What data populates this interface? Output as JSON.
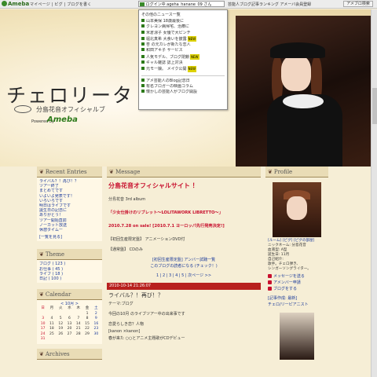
{
  "topbar": {
    "logo": "Ameba",
    "links": "マイページ | ピグ | ブログを書く",
    "status_text": "ログイン中 ageha_hanane_09 さん",
    "right_text": "芸能人ブログ記事ランキング  アメーバ会員登録",
    "action_button": "アメブロ検索"
  },
  "news_popup": {
    "heading": "その他のニュース一覧",
    "items": [
      {
        "text": "山本美保 18歳最後に",
        "tag": ""
      },
      {
        "text": "クレヨン病帰宅、治療に",
        "tag": ""
      },
      {
        "text": "米倉涼子 女優で大ピンチ",
        "tag": ""
      },
      {
        "text": "堀北真希 大食いを披露",
        "tag": "NEW"
      },
      {
        "text": "杏 の元カレが新たな恋人",
        "tag": ""
      },
      {
        "text": "和田アキ子 サービス",
        "tag": ""
      },
      {
        "text": "人気モデル、ブログ閉鎖",
        "tag": "NEW"
      },
      {
        "text": "ギャル雑誌 誌上対決",
        "tag": ""
      },
      {
        "text": "元モー娘。 メイク公開",
        "tag": "NEW"
      }
    ],
    "bottom_items": [
      "アメ芸能人のBlog記念日",
      "有名ブロガーの映画コラム",
      "懐かしの芸能人がブログ開設"
    ]
  },
  "header": {
    "title": "チェロリータ",
    "subtitle": "分島花音オフィシャルブ",
    "powered": "Powered by",
    "ameba_mark": "Ameba"
  },
  "left": {
    "recent_entries_title": "Recent Entries",
    "recent_entries": [
      "ライバル？！再び！？",
      "ツアー終了",
      "まとめてです",
      "いよいよ発表です！",
      "いろいろです",
      "明日はライブです",
      "誕生日の記念に",
      "ありがとう！",
      "ツアー開始直前",
      "ノーカット放送",
      "休憩タイムー",
      "[一覧を見る]"
    ],
    "theme_title": "Theme",
    "themes": [
      "ブログ ( 123 )",
      "お仕事 ( 45 )",
      "ライブ ( 18 )",
      "日記 ( 100 )"
    ],
    "calendar_title": "Calendar",
    "calendar_month": "< 10月 >",
    "calendar_days": [
      "日",
      "月",
      "火",
      "水",
      "木",
      "金",
      "土"
    ],
    "calendar_rows": [
      [
        "",
        "",
        "",
        "",
        "",
        "1",
        "2"
      ],
      [
        "3",
        "4",
        "5",
        "6",
        "7",
        "8",
        "9"
      ],
      [
        "10",
        "11",
        "12",
        "13",
        "14",
        "15",
        "16"
      ],
      [
        "17",
        "18",
        "19",
        "20",
        "21",
        "22",
        "23"
      ],
      [
        "24",
        "25",
        "26",
        "27",
        "28",
        "29",
        "30"
      ],
      [
        "31",
        "",
        "",
        "",
        "",
        "",
        ""
      ]
    ],
    "archives_title": "Archives"
  },
  "main": {
    "section_title": "Message",
    "message_title": "分島花音オフィシャルサイト ！",
    "line1": "分島花音 3rd album",
    "line2": "「少女仕掛けのリブレット～LOLITAWORK LIBRETTO～」",
    "line3": "2010.7.28 on sale! [2010.7.1 ヨーロッパ先行発売決定!]",
    "line4": "【初回生産限定盤】 アニメーションDVD付",
    "line5": "【通常盤】 CDのみ",
    "link1": "[初回生産限定盤] アンバー試聴一覧",
    "link2": "このブログの読者になる (チェック！)",
    "pager": "1 | 2 | 3 | 4 | 5 | 次ページ >>",
    "entry_date": "2010-10-14 21:26:07",
    "entry_title": "ライバル？！再び！？",
    "entry_theme": "テーマ:ブログ",
    "entry_lines": [
      "今回の10月 のライブツアー中の出来事です",
      "恋愛らしき恋？人物",
      "[kanon ×kanon]",
      "春が来た ○○とアニメ主題歌がCDデビュー"
    ]
  },
  "right": {
    "profile_title": "Profile",
    "profile_links": "[ルーム] [ピグ] [ピグの部屋]",
    "profile_lines": [
      "ニックネーム: 分島花音",
      "血液型: A型",
      "誕生日: 11月",
      "自己紹介:",
      "歌手。チェロ弾き、",
      "シンガーソングライター。"
    ],
    "actions": [
      "メッセージを送る",
      "アメンバー申請",
      "ブログをする"
    ],
    "news_title": "[記事作成: 最新]",
    "news_sub": "チェロ/リーピアニスト"
  }
}
